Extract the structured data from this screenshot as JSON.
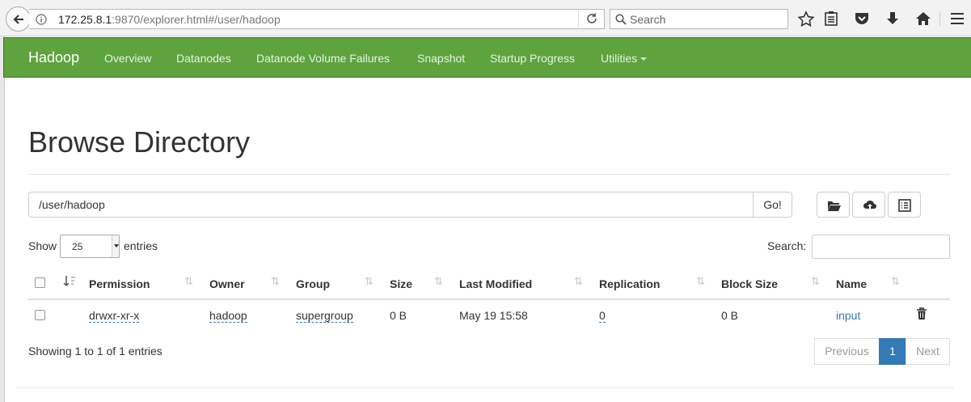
{
  "browser": {
    "url_host": "172.25.8.1",
    "url_rest": ":9870/explorer.html#/user/hadoop",
    "search_placeholder": "Search"
  },
  "navbar": {
    "brand": "Hadoop",
    "items": [
      "Overview",
      "Datanodes",
      "Datanode Volume Failures",
      "Snapshot",
      "Startup Progress",
      "Utilities"
    ]
  },
  "page": {
    "title": "Browse Directory",
    "path_value": "/user/hadoop",
    "go_label": "Go!",
    "show_label": "Show",
    "entries_value": "25",
    "entries_label": "entries",
    "search_label": "Search:"
  },
  "table": {
    "columns": [
      "Permission",
      "Owner",
      "Group",
      "Size",
      "Last Modified",
      "Replication",
      "Block Size",
      "Name"
    ],
    "rows": [
      {
        "permission": "drwxr-xr-x",
        "owner": "hadoop",
        "group": "supergroup",
        "size": "0 B",
        "last_modified": "May 19 15:58",
        "replication": "0",
        "block_size": "0 B",
        "name": "input"
      }
    ]
  },
  "footer": {
    "info": "Showing 1 to 1 of 1 entries",
    "previous": "Previous",
    "page": "1",
    "next": "Next"
  },
  "colors": {
    "navbar": "#5fa33e",
    "link": "#337ab7",
    "active_page": "#337ab7"
  }
}
